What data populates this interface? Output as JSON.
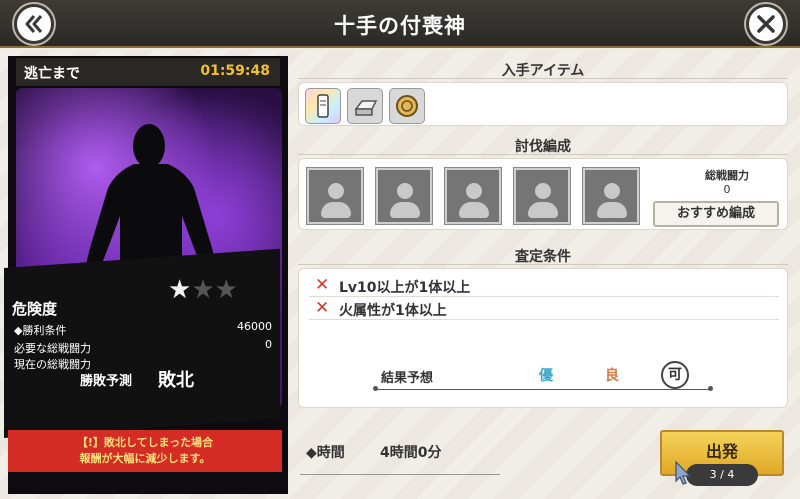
{
  "header": {
    "title": "十手の付喪神"
  },
  "card": {
    "escape_label": "逃亡まで",
    "escape_timer": "01:59:48",
    "danger_label": "危険度",
    "stars_filled": 1,
    "stars_total": 3,
    "win_condition_label": "◆勝利条件",
    "required_power_label": "必要な総戦闘力",
    "required_power_value": "46000",
    "current_power_label": "現在の総戦闘力",
    "current_power_value": "0",
    "prediction_label": "勝敗予測",
    "prediction_value": "敗北",
    "warning_line1": "【!】敗北してしまった場合",
    "warning_line2": "報酬が大幅に減少します。"
  },
  "items": {
    "title": "入手アイテム",
    "icons": [
      "ticket-icon",
      "silver-ingot-icon",
      "gold-coin-icon"
    ]
  },
  "team": {
    "title": "討伐編成",
    "slots": 5,
    "power_label": "総戦闘力",
    "power_value": "0",
    "recommend_label": "おすすめ編成"
  },
  "conditions": {
    "title": "査定条件",
    "rows": [
      "Lv10以上が1体以上",
      "火属性が1体以上"
    ],
    "forecast_label": "結果予想",
    "grades": [
      "優",
      "良",
      "可"
    ],
    "selected_grade": "可"
  },
  "footer": {
    "time_label": "◆時間",
    "time_value": "4時間0分",
    "depart_label": "出発",
    "page_indicator": "3 / 4"
  },
  "colors": {
    "header_bg": "#2b2926",
    "timer": "#f0c12c",
    "warning_bg": "#d42b25",
    "depart": "#f6d35a",
    "grade_excellent": "#3fa6c8",
    "grade_good": "#d87a44"
  }
}
